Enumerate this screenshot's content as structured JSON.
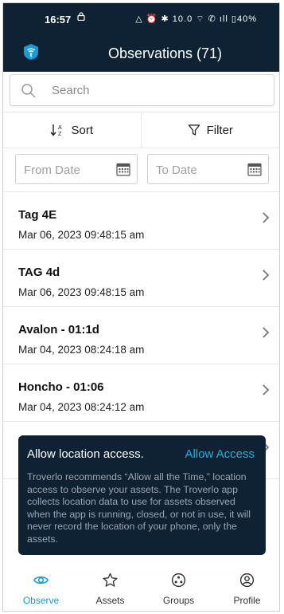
{
  "status_bar": {
    "time": "16:57",
    "right_icons": "△ ⏰ ✱ 10.0 ⌔ ✆ ıll ▯40%"
  },
  "app_bar": {
    "title": "Observations (71)",
    "logo_icon": "tag-signal-icon",
    "brand_color": "#0f2233",
    "accent_color": "#1a9ad6"
  },
  "search": {
    "placeholder": "Search",
    "value": ""
  },
  "toolbar": {
    "sort_label": "Sort",
    "filter_label": "Filter"
  },
  "date_filters": {
    "from_placeholder": "From Date",
    "to_placeholder": "To Date"
  },
  "observations": [
    {
      "name": "Tag 4E",
      "date": "Mar 06, 2023 09:48:15 am"
    },
    {
      "name": "TAG 4d",
      "date": "Mar 06, 2023 09:48:15 am"
    },
    {
      "name": "Avalon - 01:1d",
      "date": "Mar 04, 2023 08:24:18 am"
    },
    {
      "name": "Honcho - 01:06",
      "date": "Mar 04, 2023 08:24:12 am"
    }
  ],
  "location_prompt": {
    "title": "Allow location access.",
    "action_label": "Allow Access",
    "body": "Troverlo recommends “Allow all the Time,” location access to observe your assets. The Troverlo app collects location data to use for assets observed when the app is running, closed, or not in use, it will never record the location of your phone, only the assets."
  },
  "bottom_nav": [
    {
      "label": "Observe",
      "icon": "eye-icon",
      "active": true
    },
    {
      "label": "Assets",
      "icon": "star-icon",
      "active": false
    },
    {
      "label": "Groups",
      "icon": "groups-icon",
      "active": false
    },
    {
      "label": "Profile",
      "icon": "profile-icon",
      "active": false
    }
  ]
}
